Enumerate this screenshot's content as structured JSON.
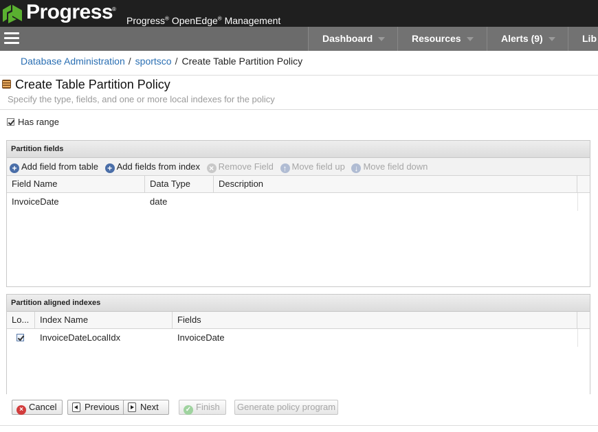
{
  "brand": {
    "logo_text": "Progress",
    "logo_reg": "®",
    "product_name_part1": "Progress",
    "product_name_part2": " OpenEdge",
    "product_name_part3": " Management",
    "reg_mark": "®",
    "brand_color": "#5ab030"
  },
  "nav": {
    "items": [
      {
        "label": "Dashboard"
      },
      {
        "label": "Resources"
      },
      {
        "label": "Alerts (9)"
      },
      {
        "label": "Lib"
      }
    ]
  },
  "breadcrumb": {
    "items": [
      {
        "label": "Database Administration"
      },
      {
        "label": "sportsco"
      },
      {
        "label": "Create Table Partition Policy"
      }
    ],
    "separator": "/"
  },
  "page": {
    "title": "Create Table Partition Policy",
    "subtitle": "Specify the type, fields, and one or more local indexes for the policy"
  },
  "has_range": {
    "label": "Has range",
    "checked": true
  },
  "partition_fields": {
    "header": "Partition fields",
    "toolbar": {
      "add_from_table": "Add field from table",
      "add_from_index": "Add fields from index",
      "remove_field": "Remove Field",
      "move_up": "Move field up",
      "move_down": "Move field down"
    },
    "columns": [
      "Field Name",
      "Data Type",
      "Description"
    ],
    "rows": [
      {
        "field_name": "InvoiceDate",
        "data_type": "date",
        "description": ""
      }
    ]
  },
  "aligned_indexes": {
    "header": "Partition aligned indexes",
    "columns": [
      "Lo...",
      "Index Name",
      "Fields"
    ],
    "rows": [
      {
        "local": true,
        "index_name": "InvoiceDateLocalIdx",
        "fields": "InvoiceDate"
      }
    ]
  },
  "buttons": {
    "cancel": "Cancel",
    "previous": "Previous",
    "next": "Next",
    "finish": "Finish",
    "generate": "Generate policy program"
  }
}
